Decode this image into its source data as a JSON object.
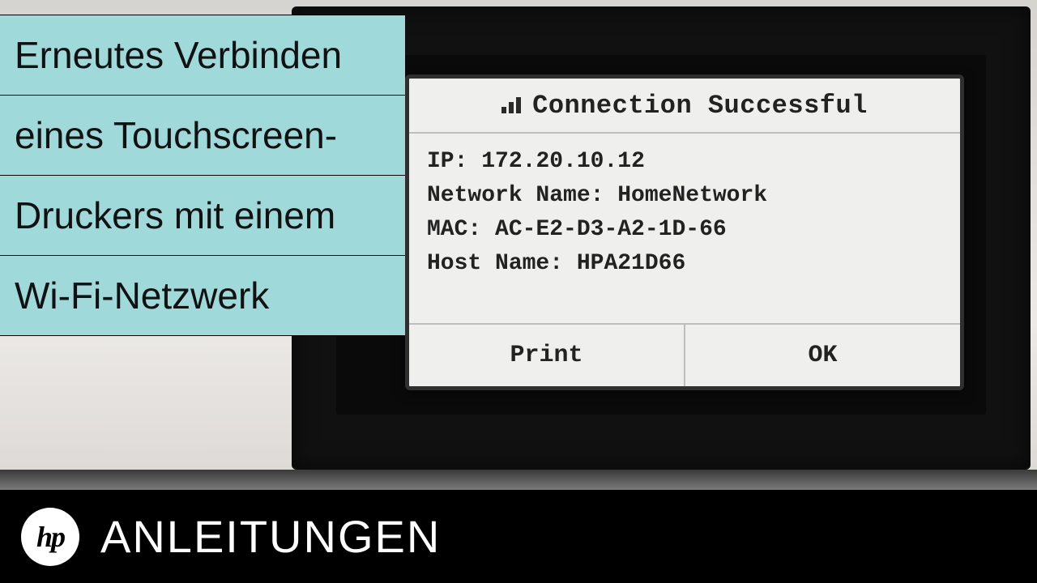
{
  "title_lines": {
    "l1": "Erneutes Verbinden",
    "l2": "eines Touchscreen-",
    "l3": "Druckers mit einem",
    "l4": "Wi-Fi-Netzwerk"
  },
  "brand": {
    "logo_text": "hp",
    "label": "ANLEITUNGEN"
  },
  "printer_screen": {
    "heading": "Connection Successful",
    "ip_label": "IP:",
    "ip_value": "172.20.10.12",
    "net_label": "Network Name:",
    "net_value": "HomeNetwork",
    "mac_label": "MAC:",
    "mac_value": "AC-E2-D3-A2-1D-66",
    "host_label": "Host Name:",
    "host_value": "HPA21D66",
    "btn_print": "Print",
    "btn_ok": "OK"
  }
}
